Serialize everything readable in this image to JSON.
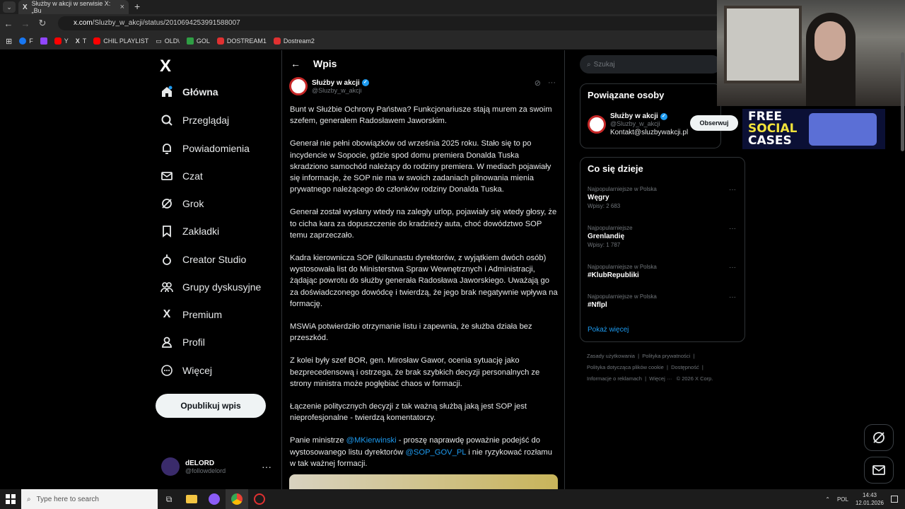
{
  "browser": {
    "tab_title": "Służby w akcji w serwisie X: „Bu",
    "tab_close": "×",
    "new_tab": "+",
    "url_host": "x.com",
    "url_path": "/Sluzby_w_akcji/status/2010694253991588007",
    "bookmarks": [
      {
        "label": "F",
        "color": "#1877f2"
      },
      {
        "label": "",
        "color": "#9146ff"
      },
      {
        "label": "Y",
        "color": "#ff0000"
      },
      {
        "label": "T",
        "color": "#ffffff"
      },
      {
        "label": "CHIL PLAYLIST",
        "color": "#ff0000"
      },
      {
        "label": "OLD\\",
        "color": "#999999"
      },
      {
        "label": "GOL",
        "color": "#2f9e44"
      },
      {
        "label": "DOSTREAM1",
        "color": "#e03131"
      },
      {
        "label": "Dostream2",
        "color": "#e03131"
      }
    ]
  },
  "sidebar": {
    "logo": "X",
    "items": [
      {
        "label": "Główna",
        "icon": "home-icon"
      },
      {
        "label": "Przeglądaj",
        "icon": "search-icon"
      },
      {
        "label": "Powiadomienia",
        "icon": "bell-icon"
      },
      {
        "label": "Czat",
        "icon": "mail-icon"
      },
      {
        "label": "Grok",
        "icon": "grok-icon"
      },
      {
        "label": "Zakładki",
        "icon": "bookmark-icon"
      },
      {
        "label": "Creator Studio",
        "icon": "creator-icon"
      },
      {
        "label": "Grupy dyskusyjne",
        "icon": "people-icon"
      },
      {
        "label": "Premium",
        "icon": "x-icon"
      },
      {
        "label": "Profil",
        "icon": "user-icon"
      },
      {
        "label": "Więcej",
        "icon": "more-circle-icon"
      }
    ],
    "post_button": "Opublikuj wpis",
    "account_name": "dELORD",
    "account_handle": "@followdelord",
    "account_more": "···"
  },
  "main": {
    "back": "←",
    "title": "Wpis",
    "author_name": "Służby w akcji",
    "author_handle": "@Sluzby_w_akcji",
    "more": "···",
    "paragraphs": [
      "Bunt w Służbie Ochrony Państwa? Funkcjonariusze stają murem za swoim szefem, generałem Radosławem Jaworskim.",
      "Generał nie pełni obowiązków od września 2025 roku. Stało się to po incydencie w Sopocie, gdzie spod domu premiera Donalda Tuska skradziono  samochód należący do rodziny premiera. W mediach pojawiały się informacje, że SOP nie ma w swoich zadaniach pilnowania mienia prywatnego należącego do członków rodziny Donalda Tuska.",
      "Generał został wysłany wtedy na zaległy urlop, pojawiały się wtedy głosy, że to cicha kara za dopuszczenie do kradzieży auta, choć dowództwo SOP temu zaprzeczało.",
      "Kadra kierownicza SOP (kilkunastu dyrektorów, z wyjątkiem dwóch osób) wystosowała list do Ministerstwa Spraw Wewnętrznych i Administracji, żądając powrotu do służby generała Radosława Jaworskiego. Uważają go za doświadczonego dowódcę i twierdzą, że jego brak negatywnie wpływa na formację.",
      "MSWiA potwierdziło otrzymanie listu i zapewnia, że służba działa bez przeszkód.",
      "Z kolei były szef BOR, gen. Mirosław Gawor, ocenia sytuację jako bezprecedensową i ostrzega, że brak szybkich decyzji personalnych ze strony ministra może pogłębiać chaos w formacji.",
      "Łączenie politycznych decyzji z tak ważną służbą jaką jest SOP jest nieprofesjonalne - twierdzą komentatorzy."
    ],
    "last_p_1": "Panie ministrze ",
    "mention_1": "@MKierwinski",
    "last_p_2": " - proszę naprawdę poważnie podejść do wystosowanego listu dyrektorów ",
    "mention_2": "@SOP_GOV_PL",
    "last_p_3": "  i nie ryzykować rozłamu w tak ważnej formacji."
  },
  "right": {
    "search_placeholder": "Szukaj",
    "related_title": "Powiązane osoby",
    "related_name": "Służby w akcji",
    "related_handle": "@Sluzby_w_akcji",
    "related_contact": "Kontakt@sluzbywakcji.pl",
    "follow_label": "Obserwuj",
    "trends_title": "Co się dzieje",
    "trends": [
      {
        "category": "Najpopularniejsze w Polska",
        "title": "Węgry",
        "count": "Wpisy: 2 683"
      },
      {
        "category": "Najpopularniejsze",
        "title": "Grenlandię",
        "count": "Wpisy: 1 787"
      },
      {
        "category": "Najpopularniejsze w Polska",
        "title": "#KlubRepubliki",
        "count": ""
      },
      {
        "category": "Najpopularniejsze w Polska",
        "title": "#Nflpl",
        "count": ""
      }
    ],
    "trend_more": "···",
    "show_more": "Pokaż więcej",
    "footer": [
      "Zasady użytkowania",
      "Polityka prywatności",
      "Polityka dotycząca plików cookie",
      "Dostępność",
      "Informacje o reklamach",
      "Więcej ···",
      "© 2026 X Corp."
    ]
  },
  "ad": {
    "line1": "FREE",
    "line2": "SOCIAL",
    "line3": "CASES"
  },
  "taskbar": {
    "search_placeholder": "Type here to search",
    "lang": "POL",
    "time": "14:43",
    "date": "12.01.2026"
  }
}
